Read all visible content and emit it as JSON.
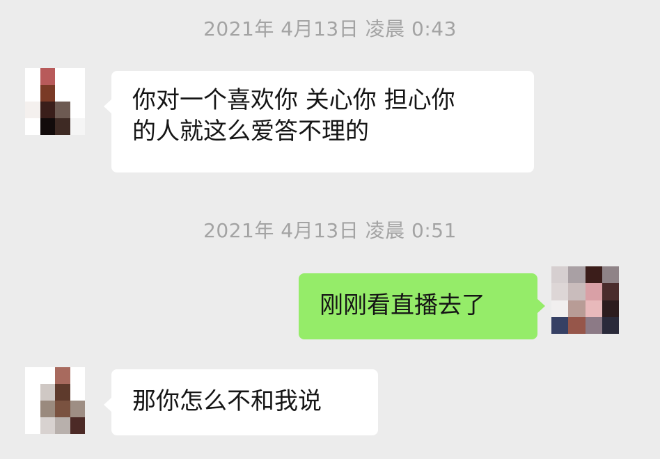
{
  "messages": [
    {
      "type": "time",
      "text": "2021年 4月13日 凌晨 0:43"
    },
    {
      "type": "msg",
      "side": "left",
      "lines": [
        "你对一个喜欢你 关心你 担心你",
        "的人就这么爱答不理的"
      ]
    },
    {
      "type": "time",
      "text": "2021年 4月13日 凌晨 0:51"
    },
    {
      "type": "msg",
      "side": "right",
      "lines": [
        "刚刚看直播去了"
      ]
    },
    {
      "type": "msg",
      "side": "left",
      "lines": [
        "那你怎么不和我说"
      ]
    }
  ],
  "avatars": {
    "contact_a": [
      "#ffffff",
      "#b85a5a",
      "#ffffff",
      "#ffffff",
      "#ffffff",
      "#7a3a26",
      "#ffffff",
      "#ffffff",
      "#f4f0ee",
      "#3a1e1a",
      "#6d5a52",
      "#ffffff",
      "#ffffff",
      "#120b0b",
      "#3e2a24",
      "#f5f5f5"
    ],
    "me": [
      "#d6cfd0",
      "#a9a0a4",
      "#3b1d1a",
      "#8f8387",
      "#ddd6d6",
      "#c9bcbc",
      "#d9a0a6",
      "#4a2c2c",
      "#f1efef",
      "#b89c96",
      "#e8b9bb",
      "#2c1c1e",
      "#364064",
      "#96564a",
      "#8c7a86",
      "#2a2a3a"
    ],
    "contact_b": [
      "#ffffff",
      "#ffffff",
      "#a86a5e",
      "#ffffff",
      "#ffffff",
      "#cfc8c4",
      "#5e3a2c",
      "#ffffff",
      "#ffffff",
      "#9a8a7e",
      "#7a5240",
      "#9e8e84",
      "#ffffff",
      "#d8d2d0",
      "#b8b0ac",
      "#4c2a26"
    ]
  },
  "colors": {
    "background": "#ececec",
    "bubble_left": "#ffffff",
    "bubble_right": "#95ec69",
    "timestamp_text": "#a3a3a3"
  }
}
